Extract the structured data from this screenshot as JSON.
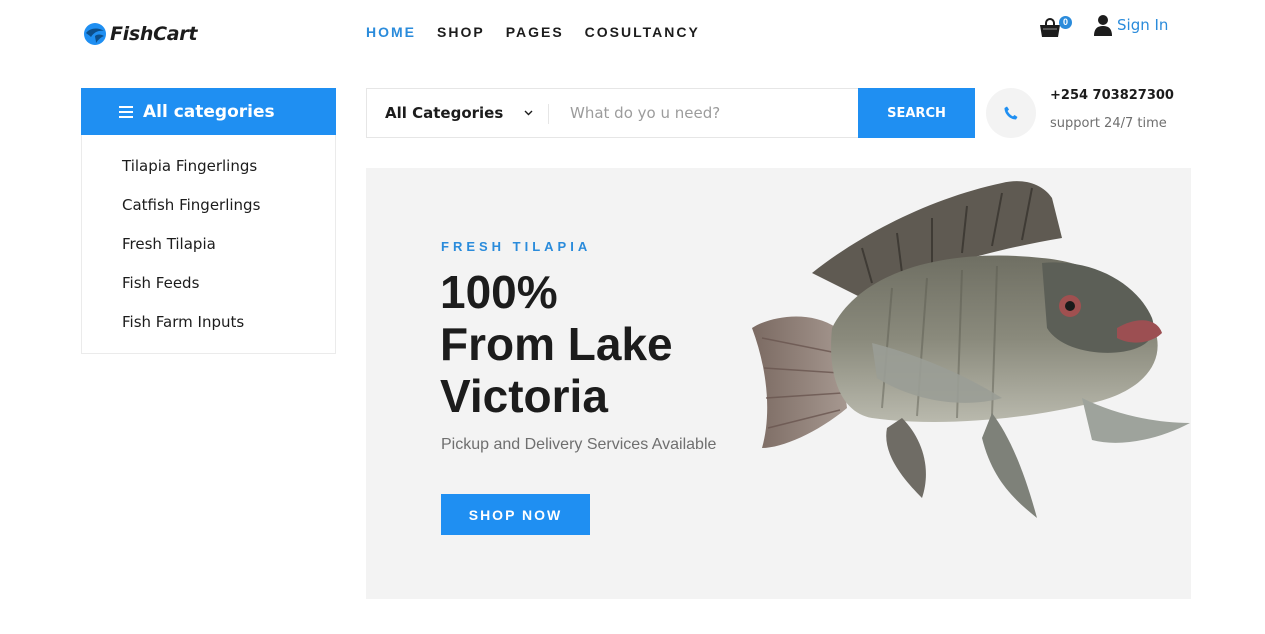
{
  "brand": {
    "name": "FishCart"
  },
  "nav": {
    "items": [
      {
        "label": "HOME",
        "active": true
      },
      {
        "label": "SHOP",
        "active": false
      },
      {
        "label": "PAGES",
        "active": false
      },
      {
        "label": "COSULTANCY",
        "active": false
      }
    ]
  },
  "cart": {
    "count": "0",
    "icon": "shopping-bag-icon"
  },
  "account": {
    "signin_label": "Sign In",
    "icon": "user-icon"
  },
  "sidebar": {
    "title": "All categories",
    "items": [
      {
        "label": "Tilapia Fingerlings"
      },
      {
        "label": "Catfish Fingerlings"
      },
      {
        "label": "Fresh Tilapia"
      },
      {
        "label": "Fish Feeds"
      },
      {
        "label": "Fish Farm Inputs"
      }
    ]
  },
  "search": {
    "category_value": "All Categories",
    "placeholder": "What do yo u need?",
    "button_label": "SEARCH"
  },
  "contact": {
    "phone": "+254 703827300",
    "support": "support 24/7 time",
    "icon": "phone-icon"
  },
  "hero": {
    "eyebrow": "FRESH TILAPIA",
    "headline_1": "100%",
    "headline_2": "From Lake",
    "headline_3": "Victoria",
    "subtitle": "Pickup and Delivery Services Available",
    "cta_label": "SHOP NOW"
  },
  "colors": {
    "accent": "#1f8ff2",
    "text": "#1c1c1c",
    "muted": "#6f6f6f",
    "hero_bg": "#f3f3f3"
  }
}
